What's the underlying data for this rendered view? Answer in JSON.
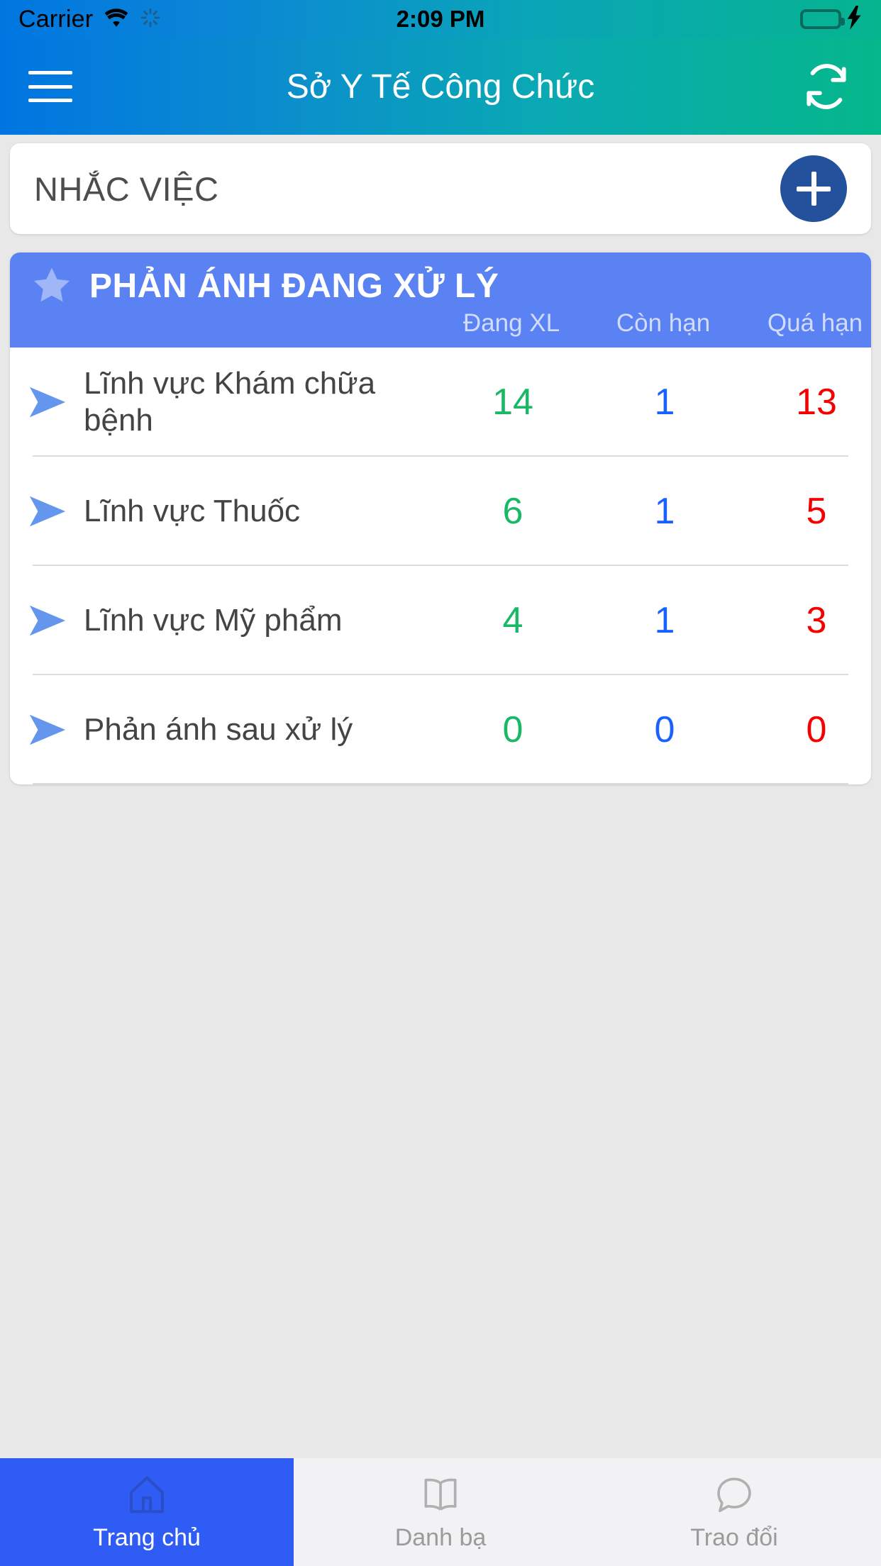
{
  "status_bar": {
    "carrier": "Carrier",
    "time": "2:09 PM",
    "wifi_icon": "wifi-icon",
    "spinner_icon": "activity-spinner-icon",
    "battery_icon": "battery-charging-icon",
    "charging_icon": "lightning-bolt-icon"
  },
  "nav": {
    "menu_icon": "hamburger-menu-icon",
    "title": "Sở Y Tế Công Chức",
    "refresh_icon": "refresh-icon"
  },
  "reminder": {
    "title": "NHẮC VIỆC",
    "add_icon": "plus-icon",
    "add_button_color": "#23519c"
  },
  "panel": {
    "star_icon": "star-icon",
    "title": "PHẢN ÁNH ĐANG XỬ LÝ",
    "header_color": "#5b82f2",
    "columns": [
      "Đang XL",
      "Còn hạn",
      "Quá hạn"
    ],
    "row_arrow_icon": "send-arrow-icon",
    "colors": {
      "processing": "#19b866",
      "on_time": "#1a62ff",
      "overdue": "#f50000"
    },
    "rows": [
      {
        "label": "Lĩnh vực Khám chữa bệnh",
        "dang_xl": "14",
        "con_han": "1",
        "qua_han": "13"
      },
      {
        "label": "Lĩnh vực Thuốc",
        "dang_xl": "6",
        "con_han": "1",
        "qua_han": "5"
      },
      {
        "label": "Lĩnh vực Mỹ phẩm",
        "dang_xl": "4",
        "con_han": "1",
        "qua_han": "3"
      },
      {
        "label": "Phản ánh sau xử lý",
        "dang_xl": "0",
        "con_han": "0",
        "qua_han": "0"
      }
    ]
  },
  "tabs": [
    {
      "label": "Trang chủ",
      "icon": "home-icon",
      "active": true
    },
    {
      "label": "Danh bạ",
      "icon": "book-icon",
      "active": false
    },
    {
      "label": "Trao đổi",
      "icon": "chat-bubble-icon",
      "active": false
    }
  ]
}
